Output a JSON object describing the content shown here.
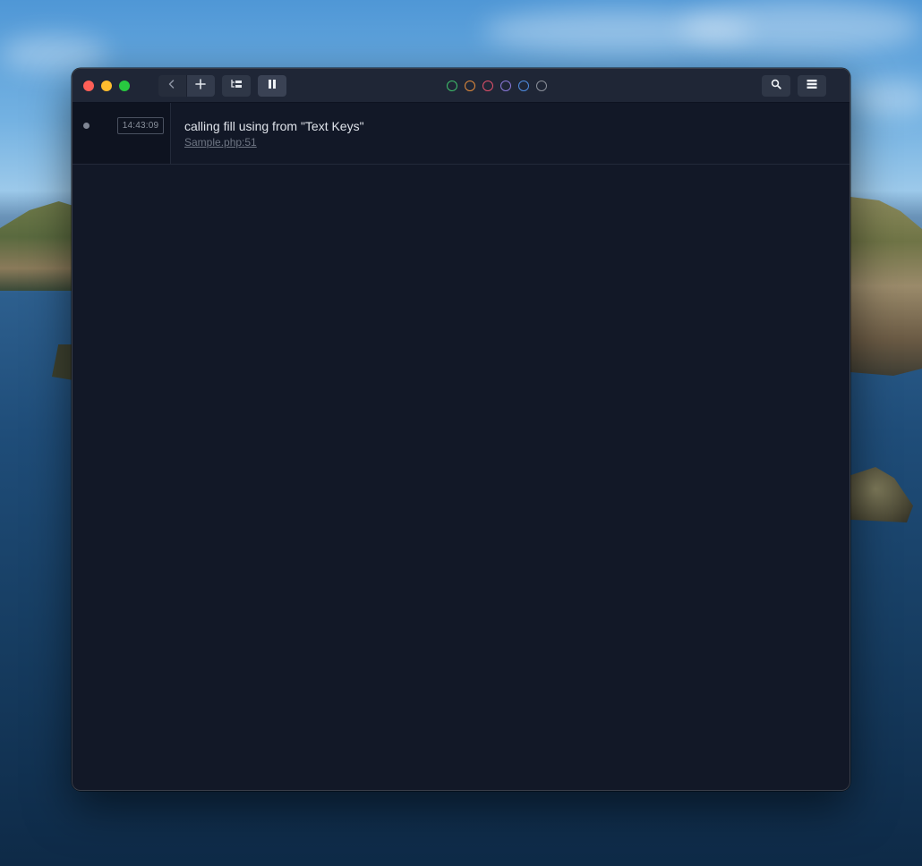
{
  "window": {
    "title": ""
  },
  "toolbar": {
    "back_icon": "chevron-left-icon",
    "add_icon": "plus-icon",
    "tree_icon": "tree-view-icon",
    "pause_icon": "pause-icon",
    "search_icon": "search-icon",
    "menu_icon": "list-menu-icon"
  },
  "color_filters": [
    {
      "name": "green",
      "color": "#3fbf6b"
    },
    {
      "name": "orange",
      "color": "#e08a3c"
    },
    {
      "name": "red",
      "color": "#e0506a"
    },
    {
      "name": "purple",
      "color": "#8a78d8"
    },
    {
      "name": "blue",
      "color": "#4f8ce0"
    },
    {
      "name": "gray",
      "color": "#8a8f99"
    }
  ],
  "log_entries": [
    {
      "time": "14:43:09",
      "message": "calling fill using from \"Text Keys\"",
      "origin": "Sample.php:51"
    }
  ]
}
